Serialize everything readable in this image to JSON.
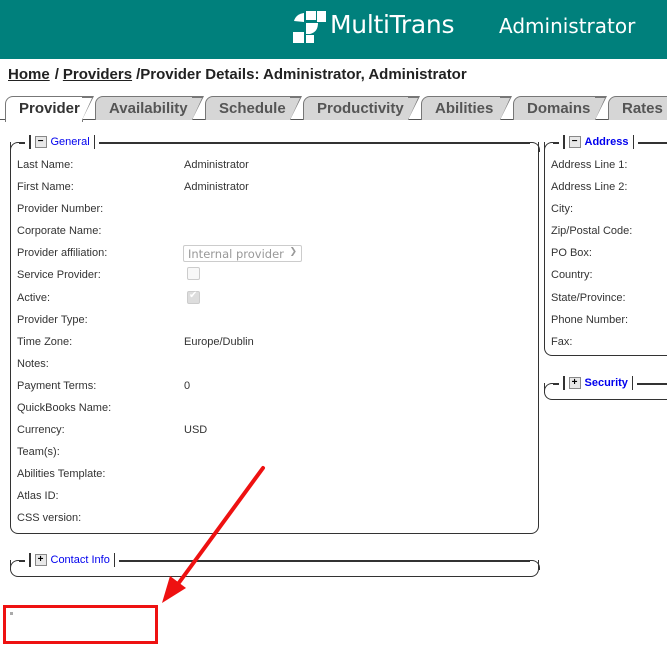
{
  "header": {
    "brand": "MultiTrans",
    "user": "Administrator",
    "bg_color": "#00807c"
  },
  "breadcrumb": {
    "home": "Home",
    "sep1": "/",
    "providers": "Providers",
    "current": "/Provider Details: Administrator, Administrator"
  },
  "tabs": [
    {
      "label": "Provider",
      "active": true
    },
    {
      "label": "Availability"
    },
    {
      "label": "Schedule"
    },
    {
      "label": "Productivity"
    },
    {
      "label": "Abilities"
    },
    {
      "label": "Domains"
    },
    {
      "label": "Rates"
    }
  ],
  "general": {
    "title": "General",
    "toggle": "−",
    "fields": [
      {
        "label": "Last Name:",
        "value": "Administrator"
      },
      {
        "label": "First Name:",
        "value": "Administrator"
      },
      {
        "label": "Provider Number:",
        "value": ""
      },
      {
        "label": "Corporate Name:",
        "value": ""
      },
      {
        "label": "Provider affiliation:",
        "value": "Internal provider"
      },
      {
        "label": "Service Provider:",
        "value": "unchecked"
      },
      {
        "label": "Active:",
        "value": "checked"
      },
      {
        "label": "Provider Type:",
        "value": ""
      },
      {
        "label": "Time Zone:",
        "value": "Europe/Dublin"
      },
      {
        "label": "Notes:",
        "value": ""
      },
      {
        "label": "Payment Terms:",
        "value": "0"
      },
      {
        "label": "QuickBooks Name:",
        "value": ""
      },
      {
        "label": "Currency:",
        "value": "USD"
      },
      {
        "label": "Team(s):",
        "value": ""
      },
      {
        "label": "Abilities Template:",
        "value": ""
      },
      {
        "label": "Atlas ID:",
        "value": ""
      },
      {
        "label": "CSS version:",
        "value": ""
      }
    ]
  },
  "address": {
    "title": "Address",
    "toggle": "−",
    "fields": [
      {
        "label": "Address Line 1:"
      },
      {
        "label": "Address Line 2:"
      },
      {
        "label": "City:"
      },
      {
        "label": "Zip/Postal Code:"
      },
      {
        "label": "PO Box:"
      },
      {
        "label": "Country:"
      },
      {
        "label": "State/Province:"
      },
      {
        "label": "Phone Number:"
      },
      {
        "label": "Fax:"
      }
    ]
  },
  "security": {
    "title": "Security",
    "toggle": "+"
  },
  "contact": {
    "title": "Contact Info",
    "toggle": "+"
  },
  "annotation": {
    "color": "#ee1111"
  }
}
